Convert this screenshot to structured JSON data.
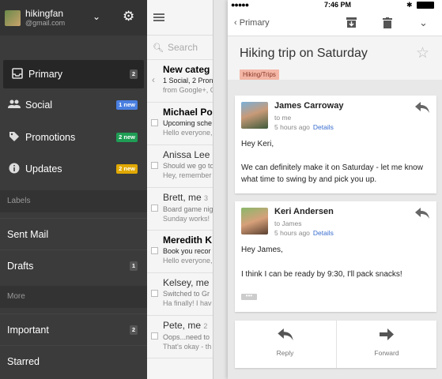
{
  "account": {
    "name": "hikingfan",
    "email": "@gmail.com"
  },
  "sidebar": {
    "categories": [
      {
        "label": "Primary",
        "badge": "2",
        "badge_color": "#555555",
        "icon": "inbox-icon"
      },
      {
        "label": "Social",
        "badge": "1 new",
        "badge_color": "#4a7fe0",
        "icon": "people-icon"
      },
      {
        "label": "Promotions",
        "badge": "2 new",
        "badge_color": "#1f9d55",
        "icon": "tag-icon"
      },
      {
        "label": "Updates",
        "badge": "2 new",
        "badge_color": "#e0a800",
        "icon": "info-icon"
      }
    ],
    "labels_header": "Labels",
    "labels": [
      {
        "label": "Sent Mail",
        "badge": ""
      },
      {
        "label": "Drafts",
        "badge": "1"
      }
    ],
    "more_header": "More",
    "more": [
      {
        "label": "Important",
        "badge": "2"
      },
      {
        "label": "Starred",
        "badge": ""
      }
    ]
  },
  "list": {
    "search_placeholder": "Search",
    "rows": [
      {
        "sender": "New categ",
        "line2": "1 Social, 2 Pron",
        "line3": "from Google+, G",
        "bold": true
      },
      {
        "sender": "Michael Po",
        "line2": "Upcoming sche",
        "line3": "Hello everyone,",
        "bold": true
      },
      {
        "sender": "Anissa Lee",
        "line2": "Should we go to",
        "line3": "Hey, remember",
        "bold": false
      },
      {
        "sender": "Brett, me",
        "count": "3",
        "line2": "Board game nig",
        "line3": "Sunday works!",
        "bold": false
      },
      {
        "sender": "Meredith K",
        "line2": "Book you recor",
        "line3": "Hello everyone,",
        "bold": true
      },
      {
        "sender": "Kelsey, me",
        "line2": "Switched to Gr",
        "line3": "Ha finally! I hav",
        "bold": false
      },
      {
        "sender": "Pete, me",
        "count": "2",
        "line2": "Oops...need to",
        "line3": "That's okay - th",
        "bold": false
      }
    ]
  },
  "status": {
    "carrier": "",
    "time": "7:46 PM",
    "bluetooth": "✱"
  },
  "toolbar": {
    "back_label": "Primary"
  },
  "thread": {
    "subject": "Hiking trip on Saturday",
    "tag": "Hiking/Trips",
    "tag_color": "#f4b6a6",
    "messages": [
      {
        "from": "James Carroway",
        "to": "to me",
        "time": "5 hours ago",
        "details": "Details",
        "body": [
          "Hey Keri,",
          "We can definitely make it on Saturday - let me know what time to swing by and pick you up."
        ]
      },
      {
        "from": "Keri Andersen",
        "to": "to James",
        "time": "5 hours ago",
        "details": "Details",
        "body": [
          "Hey James,",
          "I think I can be ready by 9:30, I'll pack snacks!"
        ],
        "ellipsis": "•••"
      }
    ],
    "reply_label": "Reply",
    "forward_label": "Forward"
  }
}
